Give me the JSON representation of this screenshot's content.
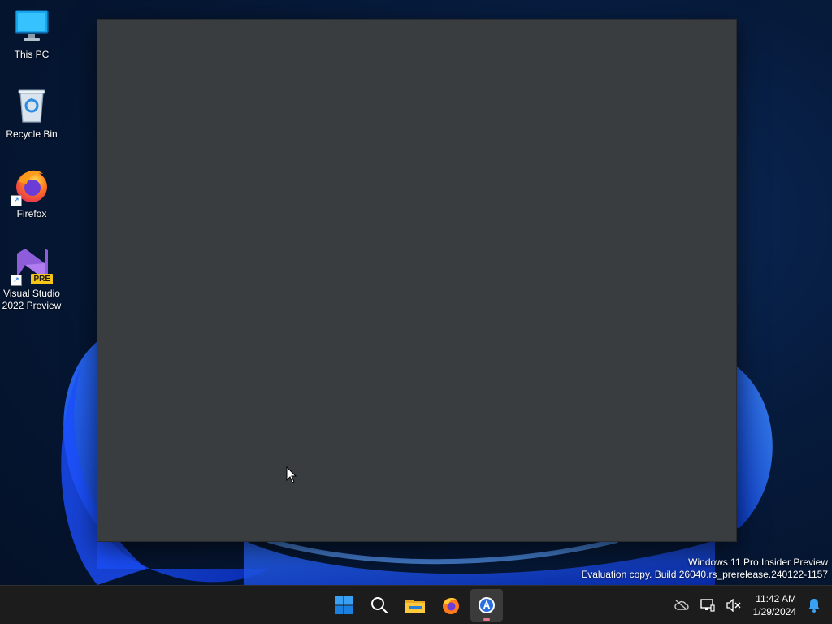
{
  "desktop": {
    "icons": [
      {
        "label": "This PC",
        "icon": "monitor-icon"
      },
      {
        "label": "Recycle Bin",
        "icon": "recycle-bin-icon"
      },
      {
        "label": "Firefox",
        "icon": "firefox-icon"
      },
      {
        "label": "Visual Studio 2022 Preview",
        "icon": "visual-studio-icon",
        "badge": "PRE"
      }
    ]
  },
  "watermark": {
    "line1": "Windows 11 Pro Insider Preview",
    "line2": "Evaluation copy. Build 26040.rs_prerelease.240122-1157"
  },
  "taskbar": {
    "apps": [
      {
        "name": "start",
        "icon": "windows-logo-icon"
      },
      {
        "name": "search",
        "icon": "search-icon"
      },
      {
        "name": "file-explorer",
        "icon": "folder-icon"
      },
      {
        "name": "firefox",
        "icon": "firefox-icon"
      },
      {
        "name": "active-app",
        "icon": "app-icon",
        "active": true
      }
    ],
    "tray": {
      "icons": [
        "onedrive-offline-icon",
        "network-icon",
        "volume-muted-icon"
      ],
      "time": "11:42 AM",
      "date": "1/29/2024",
      "notification_icon": "bell-icon"
    }
  },
  "colors": {
    "window_bg": "#3a3d40",
    "taskbar_bg": "#1c1c1c",
    "accent": "#0078d4"
  }
}
